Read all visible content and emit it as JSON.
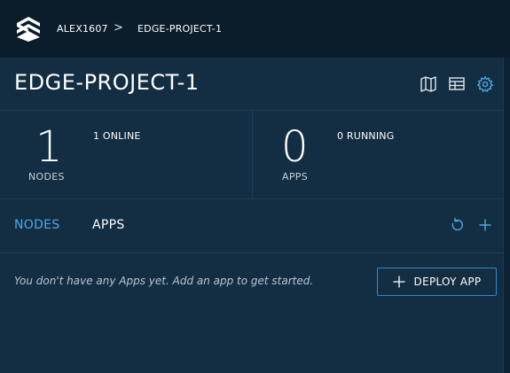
{
  "breadcrumb": {
    "user": "ALEX1607",
    "separator": ">",
    "project": "EDGE-PROJECT-1"
  },
  "header": {
    "title": "EDGE-PROJECT-1",
    "icons": [
      "map-icon",
      "table-icon",
      "gear-icon"
    ]
  },
  "stats": {
    "nodes": {
      "count": "1",
      "label": "NODES",
      "detail": "1 ONLINE"
    },
    "apps": {
      "count": "0",
      "label": "APPS",
      "detail": "0 RUNNING"
    }
  },
  "tabs": [
    {
      "label": "NODES",
      "active": true
    },
    {
      "label": "APPS",
      "active": false
    }
  ],
  "actions": {
    "icons": [
      "refresh-icon",
      "plus-icon"
    ]
  },
  "apps_panel": {
    "empty_message": "You don't have any Apps yet. Add an app to get started.",
    "deploy_label": "DEPLOY APP"
  },
  "colors": {
    "background": "#0a1a28",
    "panel": "#132d42",
    "accent": "#4da8e6",
    "button_border": "#2f8ad0"
  }
}
